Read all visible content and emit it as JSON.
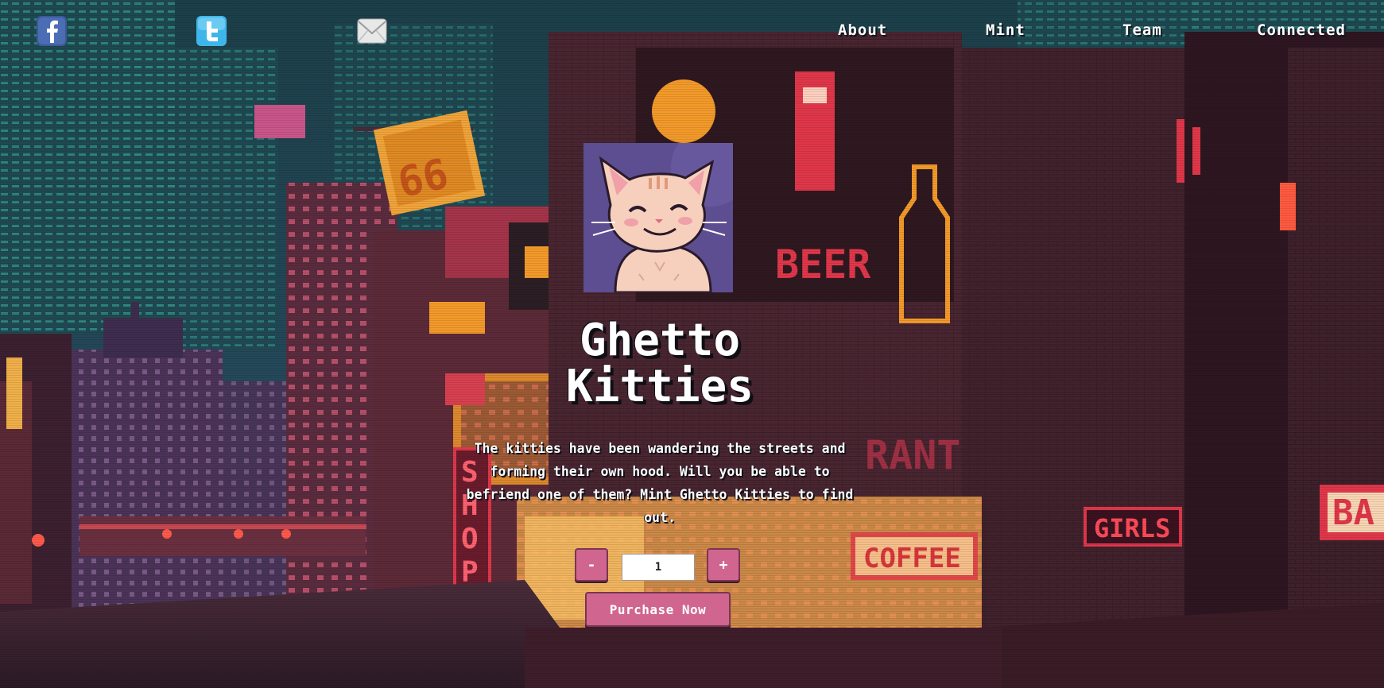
{
  "nav": {
    "social": [
      {
        "name": "facebook-icon",
        "color": "#3b5998"
      },
      {
        "name": "twitter-icon",
        "color": "#3fb6ea"
      },
      {
        "name": "mail-icon",
        "color": "#e8e8e8"
      }
    ],
    "links": {
      "about": "About",
      "mint": "Mint",
      "team": "Team",
      "connected": "Connected"
    }
  },
  "hero": {
    "title": "Ghetto Kitties",
    "description": "The kitties have been wandering the streets and forming their own hood. Will you be able to befriend one of them? Mint Ghetto Kitties to find out.",
    "minus_label": "-",
    "plus_label": "+",
    "quantity": "1",
    "purchase_label": "Purchase Now"
  },
  "scene": {
    "signs": {
      "beer": "BEER",
      "coffee": "COFFEE",
      "girls": "GIRLS",
      "shop": "SHOP",
      "restaurant": "RANT",
      "bar": "BA",
      "tower": "66"
    }
  },
  "colors": {
    "accent": "#d0668f",
    "sky": "#1d3a44",
    "neon_orange": "#f39a2a",
    "neon_red": "#e0374a"
  }
}
